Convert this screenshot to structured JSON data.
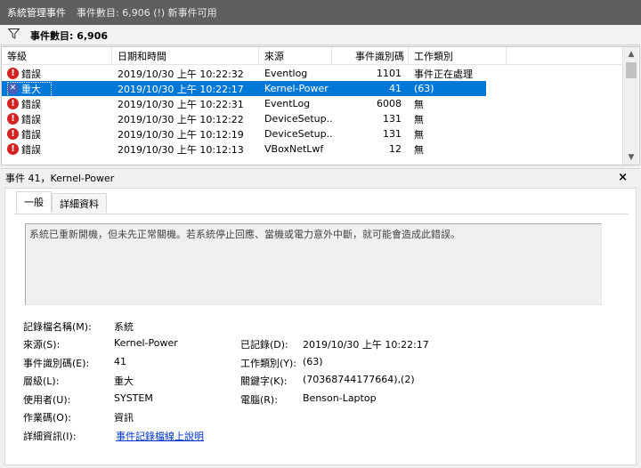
{
  "title": {
    "app": "系統管理事件",
    "subtitle": "事件數目: 6,906 (!) 新事件可用"
  },
  "filter": {
    "icon": "filter-icon",
    "text": "事件數目: 6,906"
  },
  "table": {
    "headers": [
      "等級",
      "日期和時間",
      "來源",
      "事件識別碼",
      "工作類別"
    ],
    "rows": [
      {
        "level": "錯誤",
        "icon": "error-icon",
        "date": "2019/10/30 上午 10:22:32",
        "source": "Eventlog",
        "id": "1101",
        "category": "事件正在處理"
      },
      {
        "level": "重大",
        "icon": "critical-icon",
        "date": "2019/10/30 上午 10:22:17",
        "source": "Kernel-Power",
        "id": "41",
        "category": "(63)"
      },
      {
        "level": "錯誤",
        "icon": "error-icon",
        "date": "2019/10/30 上午 10:22:31",
        "source": "EventLog",
        "id": "6008",
        "category": "無"
      },
      {
        "level": "錯誤",
        "icon": "error-icon",
        "date": "2019/10/30 上午 10:12:22",
        "source": "DeviceSetup...",
        "id": "131",
        "category": "無"
      },
      {
        "level": "錯誤",
        "icon": "error-icon",
        "date": "2019/10/30 上午 10:12:19",
        "source": "DeviceSetup...",
        "id": "131",
        "category": "無"
      },
      {
        "level": "錯誤",
        "icon": "error-icon",
        "date": "2019/10/30 上午 10:12:13",
        "source": "VBoxNetLwf",
        "id": "12",
        "category": "無"
      }
    ],
    "selected_index": 1
  },
  "detail": {
    "header": "事件 41，Kernel-Power",
    "close": "×",
    "tabs": [
      "一般",
      "詳細資料"
    ],
    "description": "系統已重新開機，但未先正常關機。若系統停止回應、當機或電力意外中斷，就可能會造成此錯誤。",
    "labels": {
      "log_name": "記錄檔名稱(M):",
      "source": "來源(S):",
      "event_id": "事件識別碼(E):",
      "level": "層級(L):",
      "user": "使用者(U):",
      "opcode": "作業碼(O):",
      "more_info": "詳細資訊(I):",
      "logged": "已記錄(D):",
      "task_category": "工作類別(Y):",
      "keywords": "關鍵字(K):",
      "computer": "電腦(R):"
    },
    "values": {
      "log_name": "系統",
      "source": "Kernel-Power",
      "event_id": "41",
      "level": "重大",
      "user": "SYSTEM",
      "opcode": "資訊",
      "more_info": "事件記錄檔線上說明",
      "logged": "2019/10/30 上午 10:22:17",
      "task_category": "(63)",
      "keywords": "(70368744177664),(2)",
      "computer": "Benson-Laptop"
    }
  },
  "colors": {
    "selection": "#0078d7",
    "error": "#d42121",
    "critical": "#4a5fb8",
    "link": "#0033cc"
  }
}
